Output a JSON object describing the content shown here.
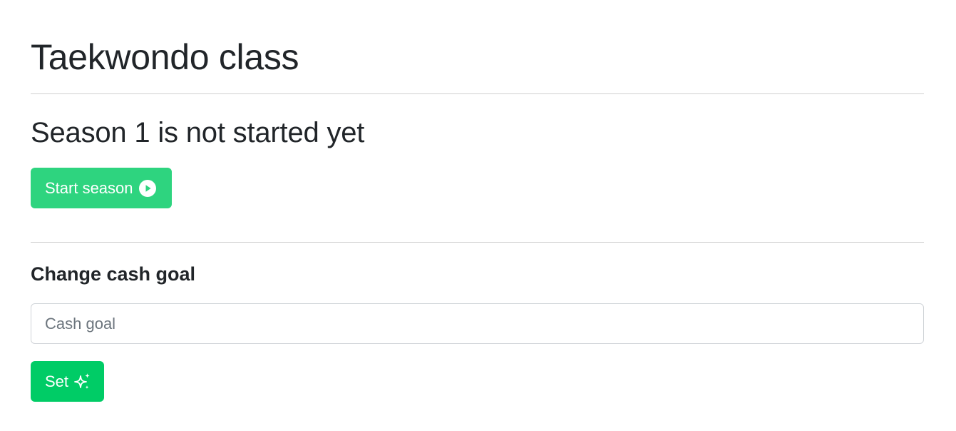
{
  "page": {
    "title": "Taekwondo class"
  },
  "season": {
    "status_text": "Season 1 is not started yet",
    "start_button_label": "Start season",
    "start_icon": "play-circle-icon"
  },
  "cash_goal": {
    "heading": "Change cash goal",
    "input_value": "",
    "input_placeholder": "Cash goal",
    "set_button_label": "Set",
    "set_icon": "sparkles-icon"
  },
  "colors": {
    "start_button": "#2ed47f",
    "set_button": "#00cc66",
    "text": "#212529",
    "divider": "#cfcfcf"
  }
}
